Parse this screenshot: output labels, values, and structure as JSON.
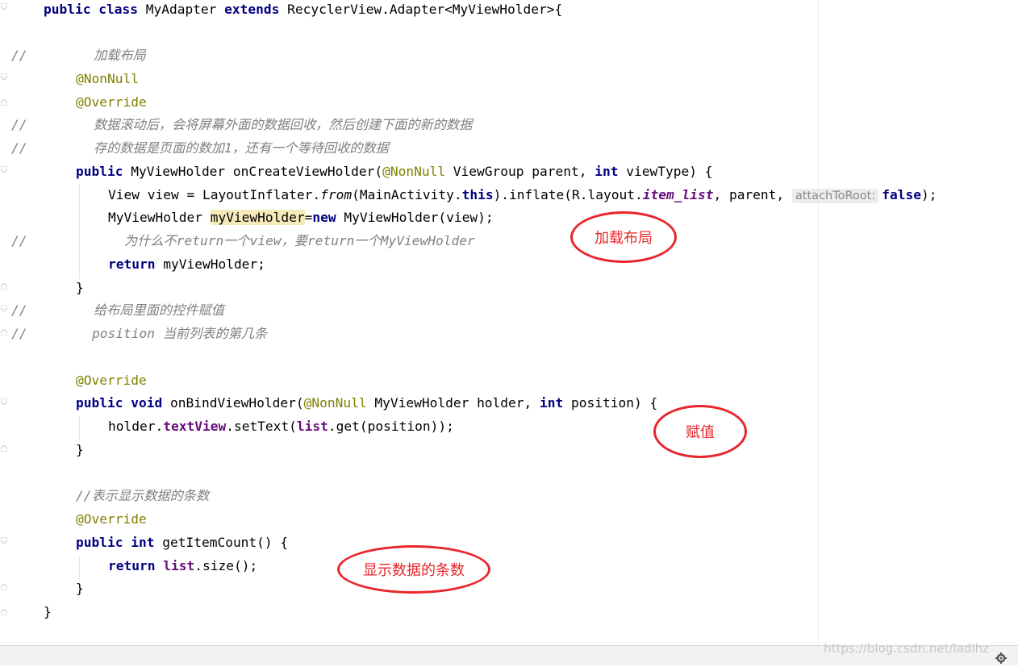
{
  "code": {
    "l1": {
      "kw1": "public",
      "kw2": "class",
      "name": " MyAdapter ",
      "kw3": "extends",
      "rest": " RecyclerView.Adapter<MyViewHolder>{"
    },
    "l3": {
      "slashes": "//",
      "comment": "加载布局"
    },
    "l4": {
      "ann": "@NonNull"
    },
    "l5": {
      "ann": "@Override"
    },
    "l6": {
      "slashes": "//",
      "comment": "数据滚动后，会将屏幕外面的数据回收，然后创建下面的新的数据"
    },
    "l7": {
      "slashes": "//",
      "comment": "存的数据是页面的数加1，还有一个等待回收的数据"
    },
    "l8": {
      "kw1": "public",
      "t1": " MyViewHolder onCreateViewHolder(",
      "ann": "@NonNull",
      "t2": " ViewGroup parent, ",
      "kw2": "int",
      "t3": " viewType) {"
    },
    "l9": {
      "t1": "View view = LayoutInflater.",
      "from": "from",
      "t2": "(MainActivity.",
      "kwthis": "this",
      "t3": ").inflate(R.layout.",
      "item": "item_list",
      "t4": ", parent, ",
      "hint": "attachToRoot:",
      "kwfalse": "false",
      "t5": ");"
    },
    "l10": {
      "t1": "MyViewHolder ",
      "var": "myViewHolder",
      "t2": "=",
      "kw": "new",
      "t3": " MyViewHolder(view);"
    },
    "l11": {
      "slashes": "//",
      "comment": "为什么不return一个view，要return一个MyViewHolder"
    },
    "l12": {
      "kw": "return",
      "t1": " myViewHolder;"
    },
    "l13": {
      "t1": "}"
    },
    "l14": {
      "slashes": "//",
      "comment": "给布局里面的控件赋值"
    },
    "l15": {
      "slashes": "//",
      "comment": "position 当前列表的第几条"
    },
    "l17": {
      "ann": "@Override"
    },
    "l18": {
      "kw1": "public",
      "kw2": "void",
      "t1": " onBindViewHolder(",
      "ann": "@NonNull",
      "t2": " MyViewHolder holder, ",
      "kw3": "int",
      "t3": " position) {"
    },
    "l19": {
      "t1": "holder.",
      "fld": "textView",
      "t2": ".setText(",
      "fld2": "list",
      "t3": ".get(position));"
    },
    "l20": {
      "t1": "}"
    },
    "l22": {
      "comment": "//表示显示数据的条数"
    },
    "l23": {
      "ann": "@Override"
    },
    "l24": {
      "kw1": "public",
      "kw2": "int",
      "t1": " getItemCount() {"
    },
    "l25": {
      "kw": "return",
      "fld": "list",
      "t1": ".size();"
    },
    "l26": {
      "t1": "}"
    },
    "l27": {
      "t1": "}"
    }
  },
  "annotations": {
    "inflate_layout": "加载布局",
    "assign_value": "赋值",
    "item_count": "显示数据的条数"
  },
  "watermark": "https://blog.csdn.net/ladihz",
  "colors": {
    "keyword": "#000080",
    "annotation": "#808000",
    "comment": "#808080",
    "field": "#660e7a",
    "callout": "#e8262b"
  }
}
